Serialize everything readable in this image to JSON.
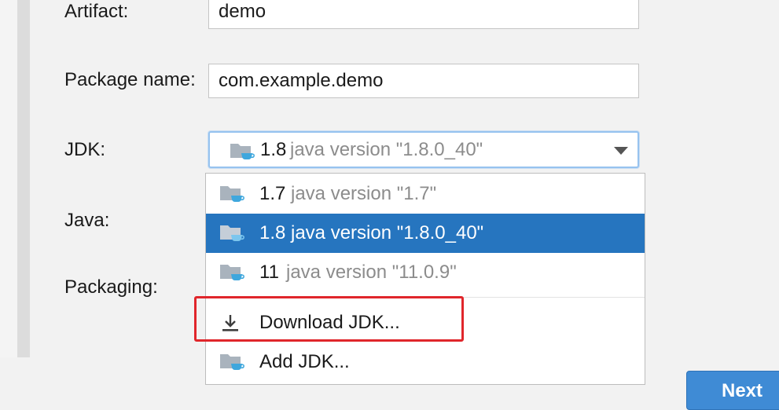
{
  "form": {
    "artifact_label": "Artifact:",
    "artifact_value": "demo",
    "package_label": "Package name:",
    "package_value": "com.example.demo",
    "jdk_label": "JDK:",
    "java_label": "Java:",
    "packaging_label": "Packaging:"
  },
  "jdk_combo": {
    "selected_version": "1.8",
    "selected_desc": "java version \"1.8.0_40\""
  },
  "jdk_dropdown": {
    "items": [
      {
        "version": "1.7",
        "desc": "java version \"1.7\"",
        "selected": false
      },
      {
        "version": "1.8",
        "desc": "java version \"1.8.0_40\"",
        "selected": true
      },
      {
        "version": "11",
        "desc": "java version \"11.0.9\"",
        "selected": false
      }
    ],
    "download_label": "Download JDK...",
    "add_label": "Add JDK..."
  },
  "footer": {
    "next_label": "Next"
  },
  "colors": {
    "selection": "#2675bf",
    "highlight_box": "#e0262b",
    "next_button": "#3f8bd5",
    "folder_icon": "#a9b3bd",
    "java_cup_icon": "#3fa7dd"
  },
  "icons": [
    "jdk-folder-icon",
    "dropdown-arrow-icon",
    "download-icon"
  ]
}
